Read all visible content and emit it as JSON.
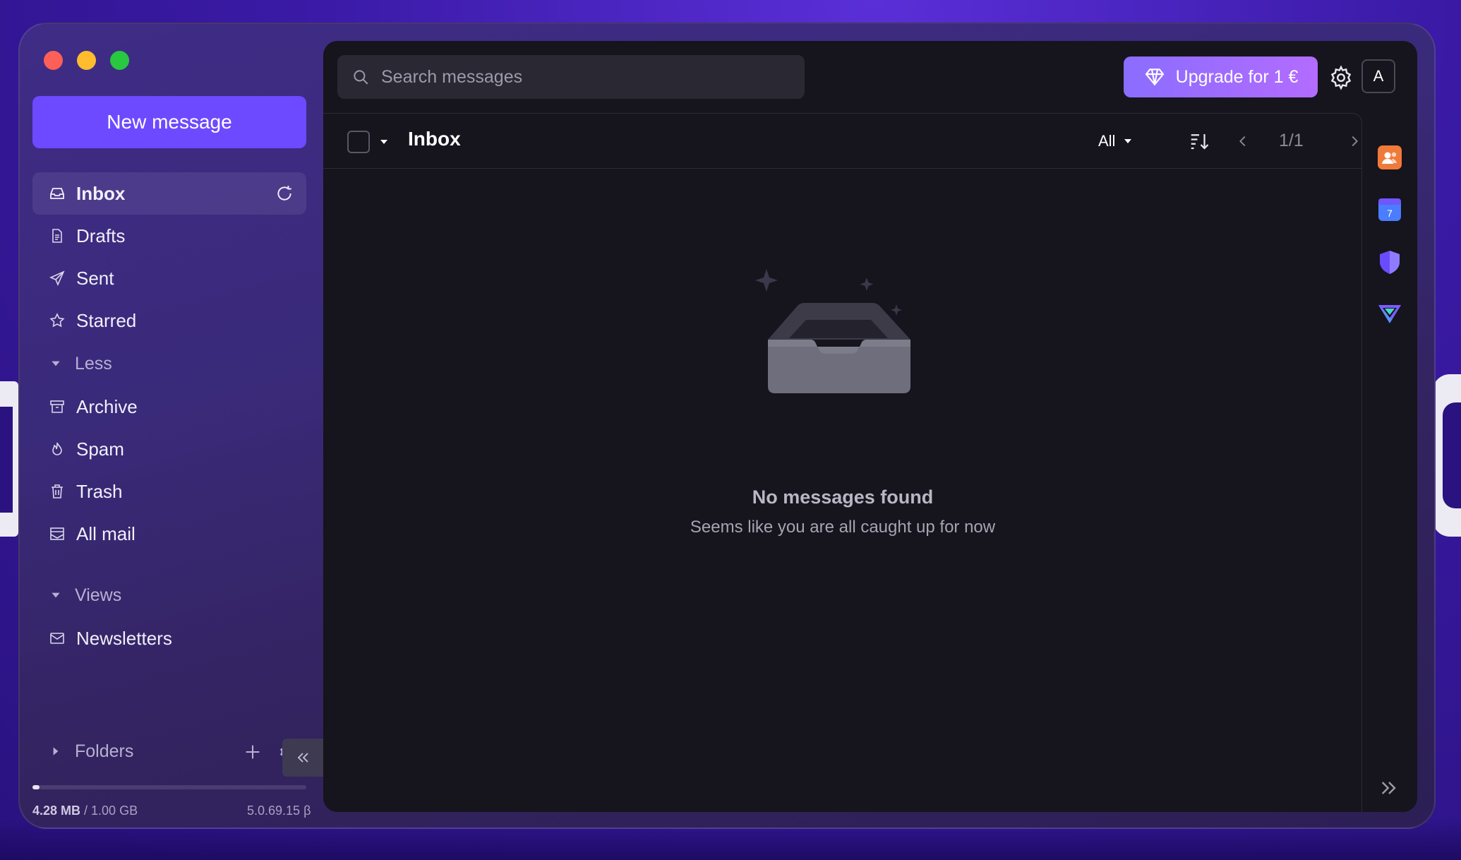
{
  "sidebar": {
    "new_message_label": "New message",
    "items": [
      {
        "label": "Inbox"
      },
      {
        "label": "Drafts"
      },
      {
        "label": "Sent"
      },
      {
        "label": "Starred"
      }
    ],
    "less_label": "Less",
    "more_items": [
      {
        "label": "Archive"
      },
      {
        "label": "Spam"
      },
      {
        "label": "Trash"
      },
      {
        "label": "All mail"
      }
    ],
    "views_label": "Views",
    "views_items": [
      {
        "label": "Newsletters"
      }
    ],
    "folders_label": "Folders",
    "storage_used": "4.28 MB",
    "storage_total": " / 1.00 GB",
    "storage_fraction": 0.004,
    "version": "5.0.69.15 β"
  },
  "header": {
    "search_placeholder": "Search messages",
    "upgrade_label": "Upgrade for 1 €",
    "avatar_initial": "A"
  },
  "list": {
    "title": "Inbox",
    "filter_label": "All",
    "pagination": "1/1",
    "empty_title": "No messages found",
    "empty_subtitle": "Seems like you are all caught up for now"
  },
  "colors": {
    "accent": "#6d4aff",
    "upgrade_start": "#8a6dff",
    "upgrade_end": "#b36cff"
  },
  "icons": [
    "search-icon",
    "diamond-icon",
    "gear-icon",
    "inbox-icon",
    "refresh-icon",
    "drafts-icon",
    "sent-icon",
    "star-icon",
    "archive-icon",
    "spam-icon",
    "trash-icon",
    "all-mail-icon",
    "newsletter-icon",
    "contacts-app-icon",
    "calendar-app-icon",
    "vpn-app-icon",
    "pass-app-icon"
  ]
}
